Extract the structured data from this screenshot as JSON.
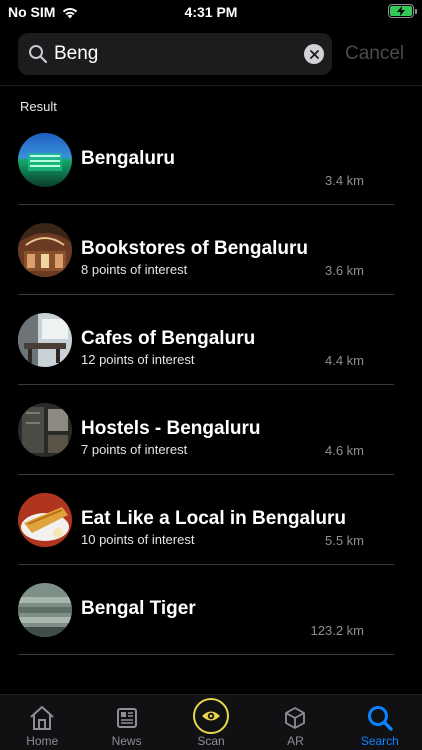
{
  "status_bar": {
    "carrier": "No SIM",
    "time": "4:31 PM"
  },
  "search": {
    "value": "Beng",
    "placeholder": "Search",
    "cancel_label": "Cancel"
  },
  "results": {
    "section_label": "Result",
    "items": [
      {
        "title": "Bengaluru",
        "subtitle": "",
        "distance": "3.4 km"
      },
      {
        "title": "Bookstores of Bengaluru",
        "subtitle": "8 points of interest",
        "distance": "3.6 km"
      },
      {
        "title": "Cafes of Bengaluru",
        "subtitle": "12 points of interest",
        "distance": "4.4 km"
      },
      {
        "title": "Hostels - Bengaluru",
        "subtitle": "7 points of interest",
        "distance": "4.6 km"
      },
      {
        "title": "Eat Like a Local in Bengaluru",
        "subtitle": "10 points of interest",
        "distance": "5.5 km"
      },
      {
        "title": "Bengal Tiger",
        "subtitle": "",
        "distance": "123.2 km"
      }
    ]
  },
  "tab_bar": {
    "tabs": [
      {
        "label": "Home",
        "icon": "home-icon"
      },
      {
        "label": "News",
        "icon": "news-icon"
      },
      {
        "label": "Scan",
        "icon": "eye-icon"
      },
      {
        "label": "AR",
        "icon": "cube-icon"
      },
      {
        "label": "Search",
        "icon": "search-icon"
      }
    ],
    "active": "Search"
  },
  "colors": {
    "accent": "#0a84ff",
    "scan_ring": "#e8d44d",
    "battery": "#34c759"
  }
}
